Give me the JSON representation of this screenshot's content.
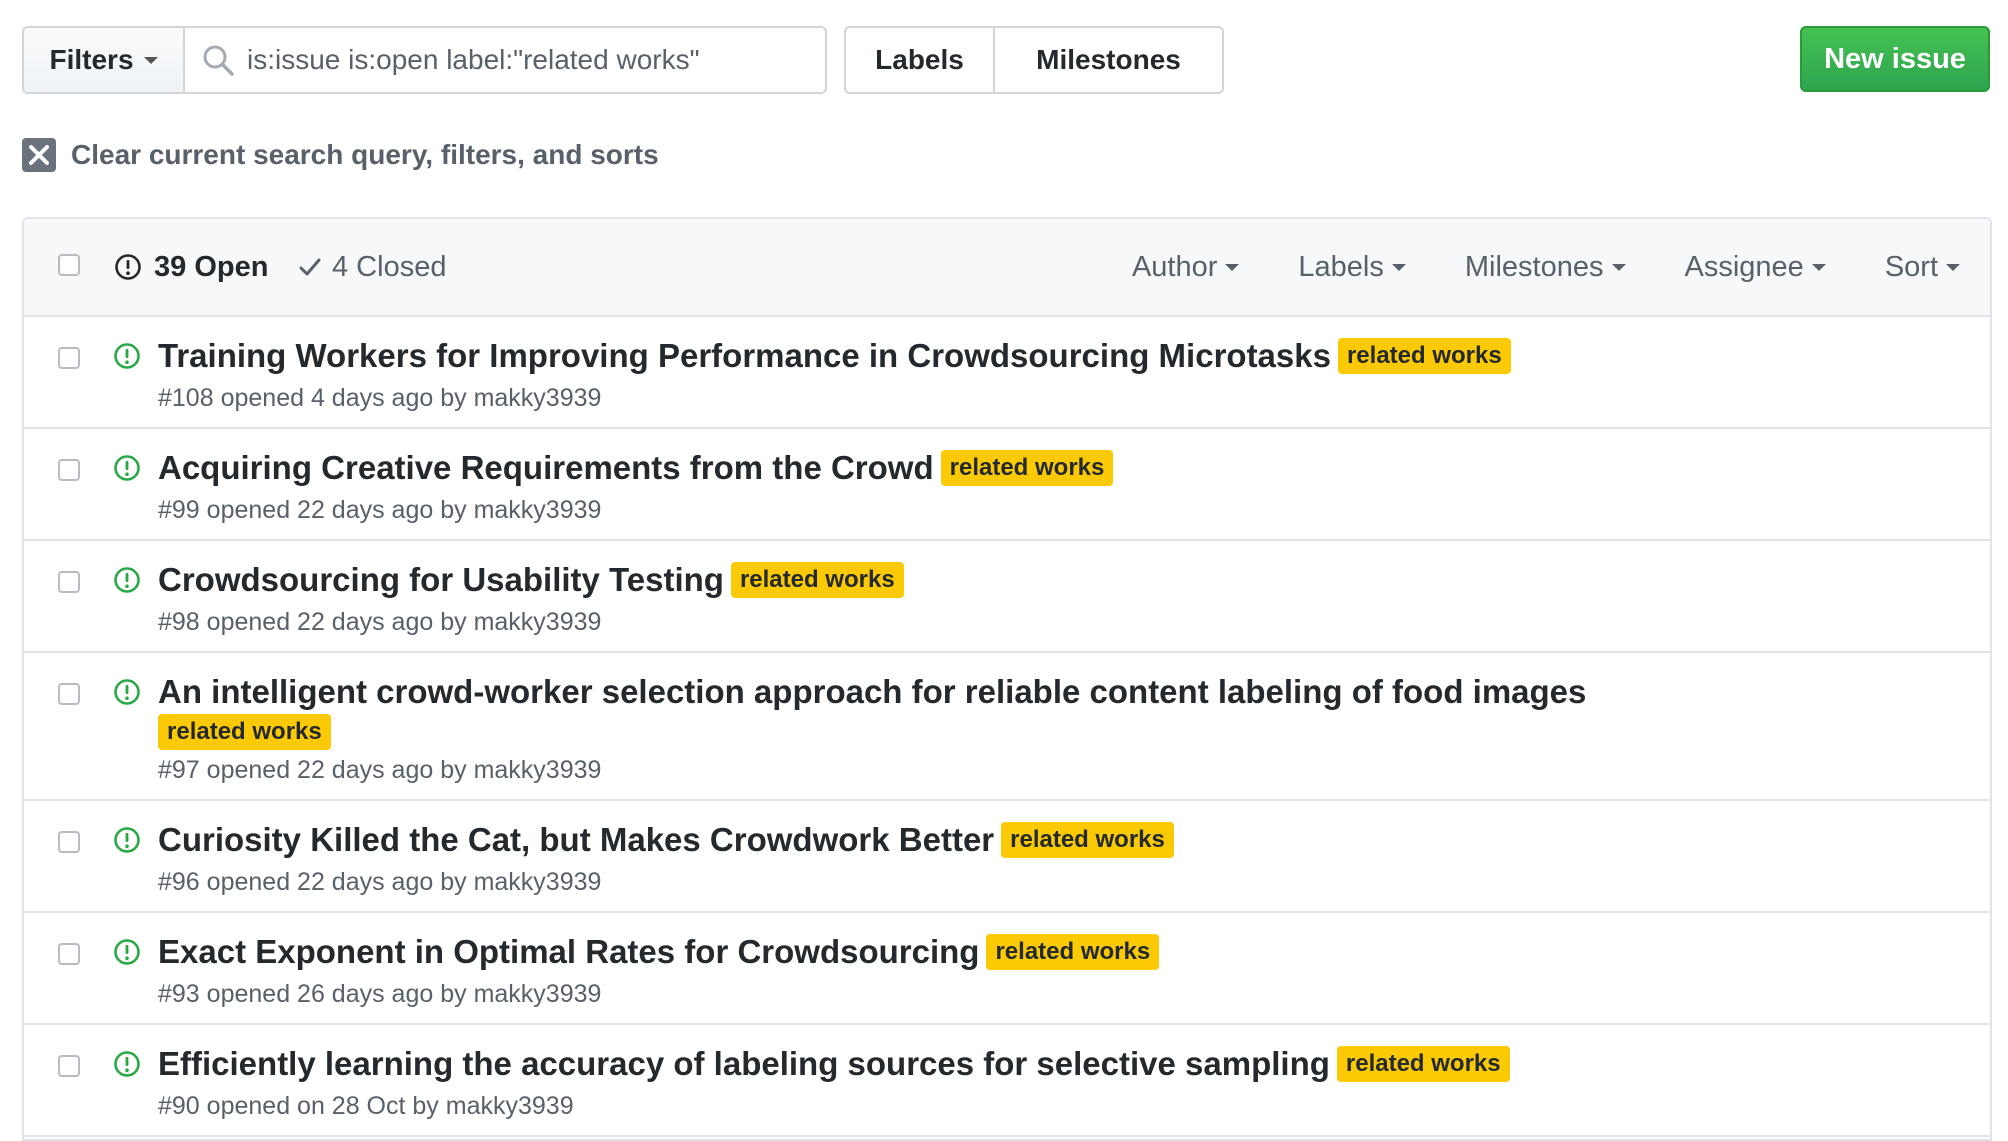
{
  "toolbar": {
    "filters_label": "Filters",
    "search_value": "is:issue is:open label:\"related works\"",
    "labels_label": "Labels",
    "milestones_label": "Milestones",
    "new_issue_label": "New issue"
  },
  "clear_query_label": "Clear current search query, filters, and sorts",
  "header": {
    "open_label": "39 Open",
    "closed_label": "4 Closed",
    "filters": {
      "author": "Author",
      "labels": "Labels",
      "milestones": "Milestones",
      "assignee": "Assignee",
      "sort": "Sort"
    }
  },
  "colors": {
    "label_bg": "#fbca04",
    "open_icon": "#28a745",
    "new_issue_bg": "#2ea44f"
  },
  "issues": [
    {
      "title": "Training Workers for Improving Performance in Crowdsourcing Microtasks",
      "label": "related works",
      "number": "#108",
      "opened": "opened 4 days ago by",
      "author": "makky3939"
    },
    {
      "title": "Acquiring Creative Requirements from the Crowd",
      "label": "related works",
      "number": "#99",
      "opened": "opened 22 days ago by",
      "author": "makky3939"
    },
    {
      "title": "Crowdsourcing for Usability Testing",
      "label": "related works",
      "number": "#98",
      "opened": "opened 22 days ago by",
      "author": "makky3939"
    },
    {
      "title": "An intelligent crowd-worker selection approach for reliable content labeling of food images",
      "label": "related works",
      "number": "#97",
      "opened": "opened 22 days ago by",
      "author": "makky3939"
    },
    {
      "title": "Curiosity Killed the Cat, but Makes Crowdwork Better",
      "label": "related works",
      "number": "#96",
      "opened": "opened 22 days ago by",
      "author": "makky3939"
    },
    {
      "title": "Exact Exponent in Optimal Rates for Crowdsourcing",
      "label": "related works",
      "number": "#93",
      "opened": "opened 26 days ago by",
      "author": "makky3939"
    },
    {
      "title": "Efficiently learning the accuracy of labeling sources for selective sampling",
      "label": "related works",
      "number": "#90",
      "opened": "opened on 28 Oct by",
      "author": "makky3939"
    }
  ]
}
